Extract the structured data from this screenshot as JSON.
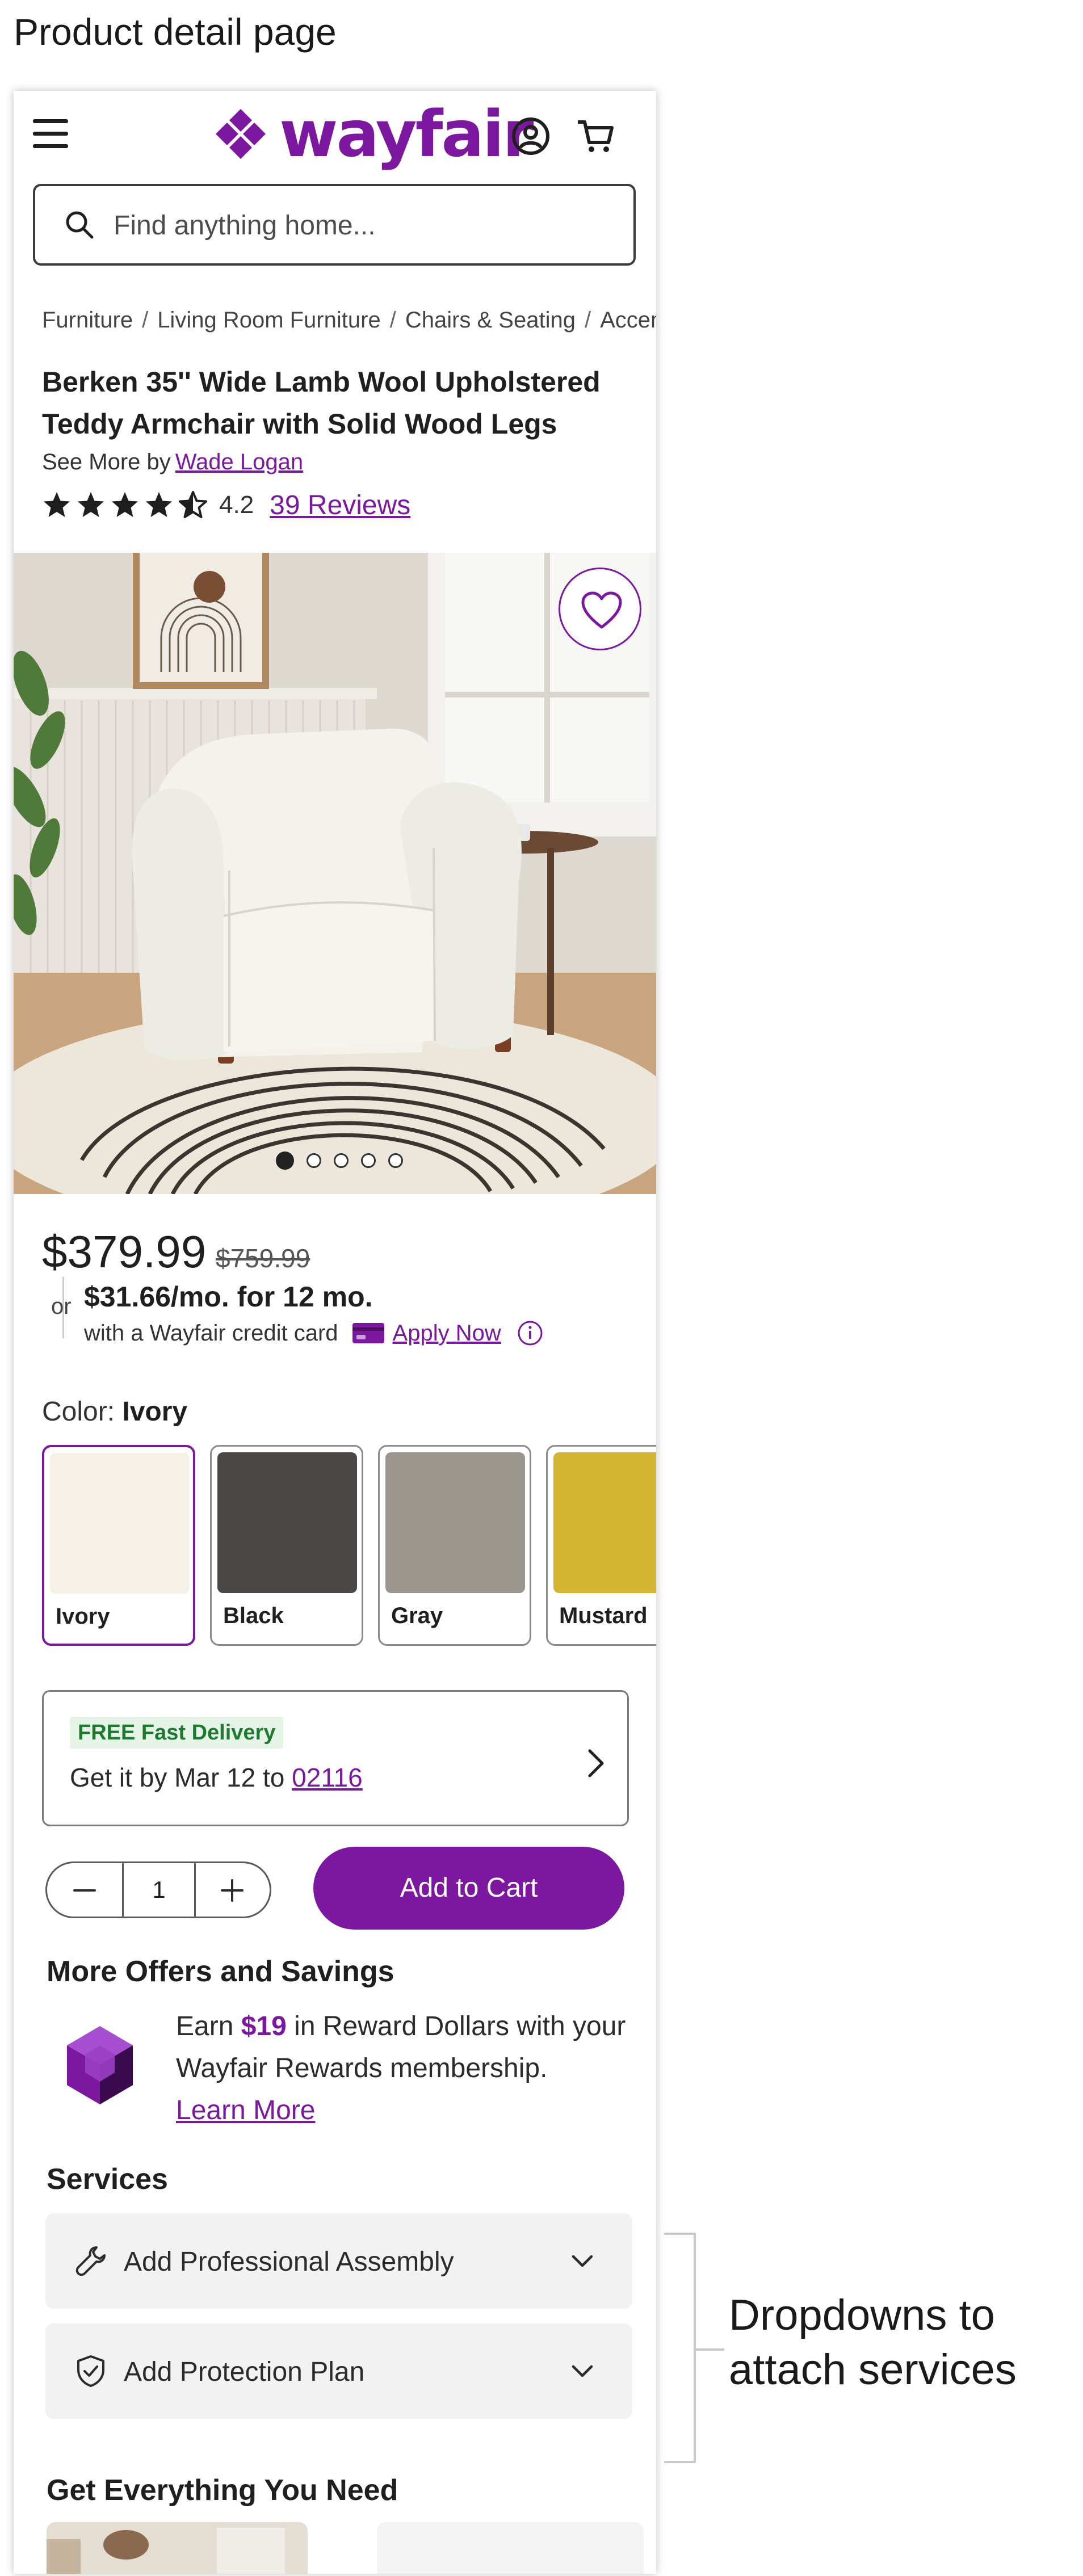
{
  "caption": "Product detail page",
  "header": {
    "logo_text": "wayfair",
    "menu_icon": "hamburger-menu-icon",
    "account_icon": "account-icon",
    "cart_icon": "cart-icon",
    "brand_color": "#7b189f"
  },
  "search": {
    "placeholder": "Find anything home..."
  },
  "breadcrumb": [
    "Furniture",
    "Living Room Furniture",
    "Chairs & Seating",
    "Accent"
  ],
  "product": {
    "title": "Berken 35'' Wide Lamb Wool Upholstered Teddy Armchair with Solid Wood Legs",
    "see_more_prefix": "See More by",
    "brand": "Wade Logan",
    "rating": "4.2",
    "rating_value": 4.2,
    "reviews": "39 Reviews",
    "image_count": 5,
    "active_image_index": 0
  },
  "pricing": {
    "price": "$379.99",
    "old_price": "$759.99",
    "or": "or",
    "monthly": "$31.66/mo. for 12 mo.",
    "credit_text": "with a Wayfair credit card",
    "apply_label": "Apply Now"
  },
  "color": {
    "label": "Color:",
    "selected": "Ivory",
    "options": [
      {
        "name": "Ivory",
        "hex": "#f5f1e6"
      },
      {
        "name": "Black",
        "hex": "#4a4746"
      },
      {
        "name": "Gray",
        "hex": "#9a968d"
      },
      {
        "name": "Mustard",
        "hex": "#d4b532"
      }
    ]
  },
  "delivery": {
    "badge": "FREE Fast Delivery",
    "text": "Get it by Mar 12 to",
    "zip": "02116"
  },
  "cart": {
    "quantity": "1",
    "add_label": "Add to Cart"
  },
  "offers": {
    "heading": "More Offers and Savings",
    "earn": "Earn",
    "amount": "$19",
    "text": "in Reward Dollars with your Wayfair Rewards membership.",
    "learn_more": "Learn More"
  },
  "services": {
    "heading": "Services",
    "items": [
      {
        "label": "Add Professional Assembly",
        "icon": "wrench-icon"
      },
      {
        "label": "Add Protection Plan",
        "icon": "shield-check-icon"
      }
    ]
  },
  "get_everything": {
    "heading": "Get Everything You Need"
  },
  "annotation": "Dropdowns to attach services"
}
